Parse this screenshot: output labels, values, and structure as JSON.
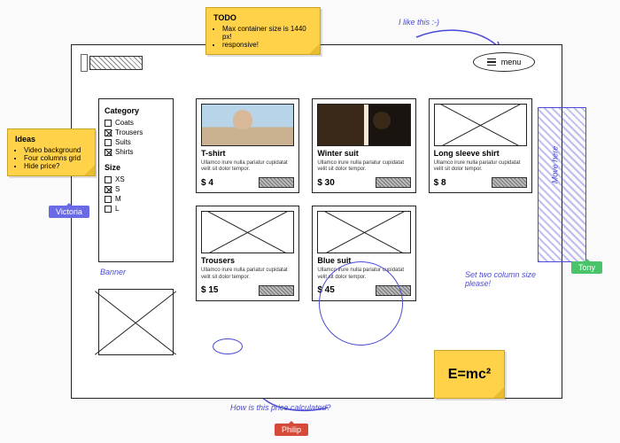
{
  "frame": {
    "menu_label": "menu"
  },
  "sidebar": {
    "cat_heading": "Category",
    "categories": [
      {
        "label": "Coats",
        "checked": false
      },
      {
        "label": "Trousers",
        "checked": true
      },
      {
        "label": "Suits",
        "checked": false
      },
      {
        "label": "Shirts",
        "checked": true
      }
    ],
    "size_heading": "Size",
    "sizes": [
      {
        "label": "XS",
        "checked": false
      },
      {
        "label": "S",
        "checked": true
      },
      {
        "label": "M",
        "checked": false
      },
      {
        "label": "L",
        "checked": false
      }
    ]
  },
  "cards": [
    {
      "title": "T-shirt",
      "desc": "Ullamco irure nulla pariatur cupidatat velit sit dolor tempor.",
      "price": "$ 4"
    },
    {
      "title": "Winter suit",
      "desc": "Ullamco irure nulla pariatur cupidatat velit sit dolor tempor.",
      "price": "$ 30"
    },
    {
      "title": "Long sleeve shirt",
      "desc": "Ullamco irure nulla pariatur cupidatat velit sit dolor tempor.",
      "price": "$ 8"
    },
    {
      "title": "Trousers",
      "desc": "Ullamco irure nulla pariatur cupidatat velit sit dolor tempor.",
      "price": "$ 15"
    },
    {
      "title": "Blue suit",
      "desc": "Ullamco irure nulla pariatur cupidatat velit sit dolor tempor.",
      "price": "$ 45"
    }
  ],
  "notes": {
    "todo_title": "TODO",
    "todo_items": [
      "Max container size is 1440 px!",
      "responsive!"
    ],
    "ideas_title": "Ideas",
    "ideas_items": [
      "Video background",
      "Four columns grid",
      "Hide price?"
    ],
    "formula": "E=mc²"
  },
  "annotations": {
    "like": "I like this :-)",
    "banner": "Banner",
    "move": "Move here",
    "two_col": "Set two column size please!",
    "price_q": "How is this price calculated?"
  },
  "users": {
    "victoria": "Victoria",
    "philip": "Philip",
    "tony": "Tony"
  }
}
